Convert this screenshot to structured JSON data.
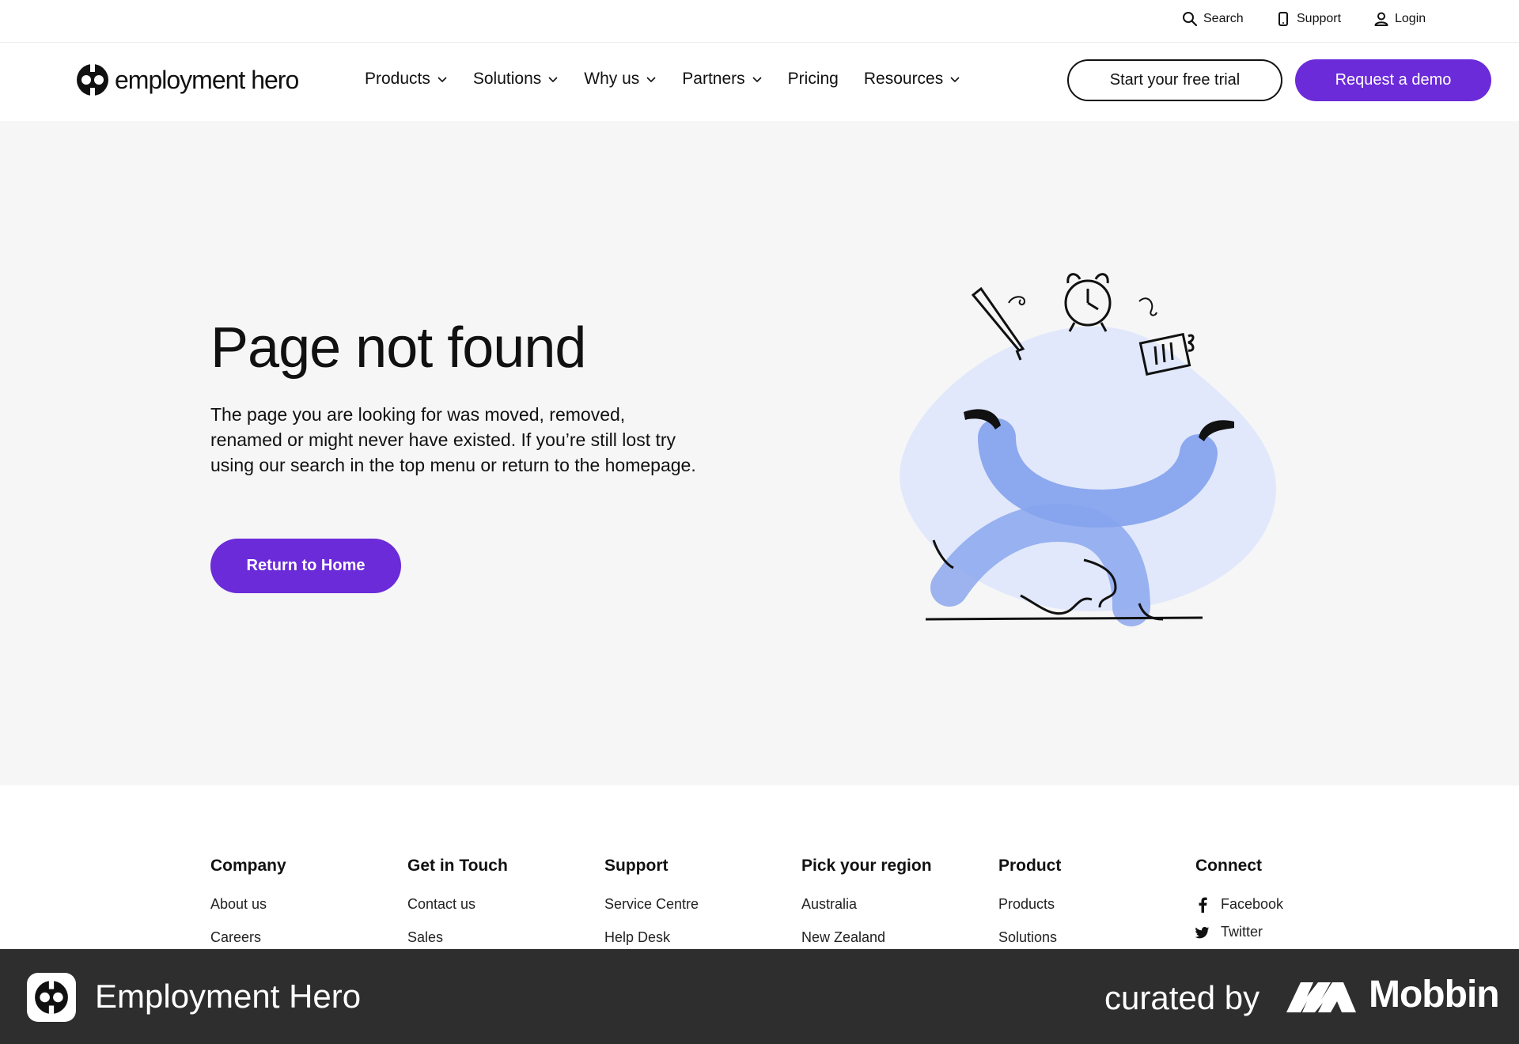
{
  "utility_bar": {
    "search": "Search",
    "support": "Support",
    "login": "Login"
  },
  "brand": {
    "name": "employment hero",
    "accent_color": "#6b2bd9"
  },
  "nav": {
    "items": [
      {
        "label": "Products",
        "dropdown": true
      },
      {
        "label": "Solutions",
        "dropdown": true
      },
      {
        "label": "Why us",
        "dropdown": true
      },
      {
        "label": "Partners",
        "dropdown": true
      },
      {
        "label": "Pricing",
        "dropdown": false
      },
      {
        "label": "Resources",
        "dropdown": true
      }
    ],
    "trial_button": "Start your free trial",
    "demo_button": "Request a demo"
  },
  "hero": {
    "title": "Page not found",
    "body": "The page you are looking for was moved, removed, renamed or might never have existed. If you’re still lost try using our search in the top menu or return to the homepage.",
    "button": "Return to Home"
  },
  "footer": {
    "columns": [
      {
        "heading": "Company",
        "links": [
          "About us",
          "Careers"
        ]
      },
      {
        "heading": "Get in Touch",
        "links": [
          "Contact us",
          "Sales"
        ]
      },
      {
        "heading": "Support",
        "links": [
          "Service Centre",
          "Help Desk"
        ]
      },
      {
        "heading": "Pick your region",
        "links": [
          "Australia",
          "New Zealand"
        ]
      },
      {
        "heading": "Product",
        "links": [
          "Products",
          "Solutions"
        ]
      }
    ],
    "connect": {
      "heading": "Connect",
      "links": [
        "Facebook",
        "Twitter"
      ]
    }
  },
  "credit_bar": {
    "app_name": "Employment Hero",
    "curated_by": "curated by",
    "curator": "Mobbin"
  }
}
